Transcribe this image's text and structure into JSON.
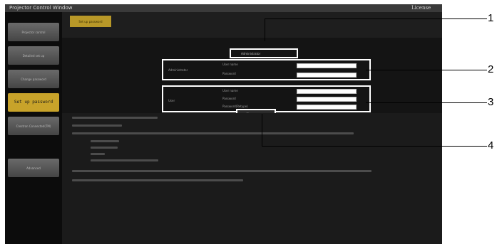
{
  "titlebar": {
    "app_title": "Projector Control Window",
    "license_link": "License"
  },
  "sidebar": {
    "items": [
      {
        "label": "Projector control"
      },
      {
        "label": "Detailed set up"
      },
      {
        "label": "Change password"
      },
      {
        "label": "Set up password",
        "active": true
      },
      {
        "label": "Crestron Connected(TM)"
      },
      {
        "label": "Advanced"
      }
    ]
  },
  "main": {
    "top_tab": "Set up password",
    "account_select": "Administrator",
    "admin_section": {
      "title": "Administrator",
      "user_name_label": "User name",
      "password_label": "Password"
    },
    "user_section": {
      "title": "User",
      "user_name_label": "User name",
      "password_label": "Password",
      "confirm_label": "Password(Retype)"
    },
    "change_button": "Change"
  },
  "callouts": [
    "1",
    "2",
    "3",
    "4"
  ]
}
